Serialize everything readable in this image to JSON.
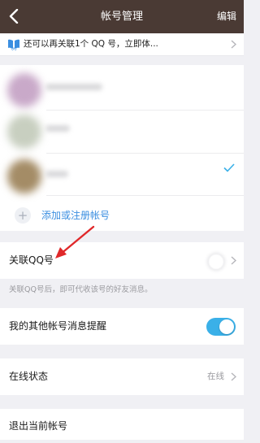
{
  "header": {
    "title": "帐号管理",
    "edit_label": "编辑",
    "bg_color": "#4a3a34"
  },
  "banner": {
    "icon": "qq-icon",
    "text": "还可以再关联1个 QQ 号，立即体..."
  },
  "accounts": {
    "rows": [
      {
        "avatar": "blurred-avatar"
      },
      {
        "avatar": "blurred-avatar"
      },
      {
        "avatar": "blurred-avatar",
        "selected": true
      }
    ],
    "add_label": "添加或注册帐号",
    "accent_color": "#3a8ee0"
  },
  "link_qq": {
    "label": "关联QQ号",
    "hint": "关联QQ号后，即可代收该号的好友消息。"
  },
  "other_accounts_notify": {
    "label": "我的其他帐号消息提醒",
    "toggle_on": true,
    "toggle_color": "#3ab0e8"
  },
  "online_status": {
    "label": "在线状态",
    "value": "在线"
  },
  "logout": {
    "label": "退出当前帐号"
  }
}
